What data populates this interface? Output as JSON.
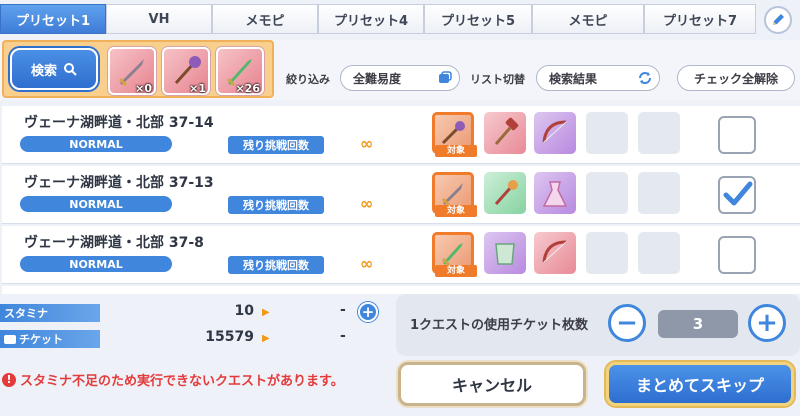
{
  "tabs": [
    {
      "label": "プリセット1",
      "active": true
    },
    {
      "label": "VH",
      "active": false
    },
    {
      "label": "メモピ",
      "active": false
    },
    {
      "label": "プリセット4",
      "active": false
    },
    {
      "label": "プリセット5",
      "active": false
    },
    {
      "label": "メモピ",
      "active": false
    },
    {
      "label": "プリセット7",
      "active": false
    }
  ],
  "edit_icon": "pencil-icon",
  "search": {
    "button_label": "検索",
    "icon": "magnifier-icon",
    "items": [
      {
        "icon": "sword-icon",
        "count": "×0"
      },
      {
        "icon": "staff-icon",
        "count": "×1"
      },
      {
        "icon": "green-sword-icon",
        "count": "×26"
      }
    ]
  },
  "filters": {
    "narrow_label": "絞り込み",
    "narrow_value": "全難易度",
    "list_switch_label": "リスト切替",
    "list_switch_value": "検索結果",
    "uncheck_all_label": "チェック全解除"
  },
  "quests": [
    {
      "name": "ヴェーナ湖畔道・北部 37-14",
      "difficulty": "NORMAL",
      "remaining_label": "残り挑戦回数",
      "remaining": "∞",
      "target_tag": "対象",
      "checked": false,
      "drops": [
        "staff-icon",
        "hammer-icon",
        "bow-icon"
      ]
    },
    {
      "name": "ヴェーナ湖畔道・北部 37-13",
      "difficulty": "NORMAL",
      "remaining_label": "残り挑戦回数",
      "remaining": "∞",
      "target_tag": "対象",
      "checked": true,
      "drops": [
        "sword-icon",
        "wand-icon",
        "dress-icon"
      ]
    },
    {
      "name": "ヴェーナ湖畔道・北部 37-8",
      "difficulty": "NORMAL",
      "remaining_label": "残り挑戦回数",
      "remaining": "∞",
      "target_tag": "対象",
      "checked": false,
      "drops": [
        "green-sword-icon",
        "armor-icon",
        "bow-icon"
      ]
    }
  ],
  "stats": {
    "stamina_label": "スタミナ",
    "stamina_value": "10",
    "stamina_after": "-",
    "ticket_label": "チケット",
    "ticket_value": "15579",
    "ticket_after": "-"
  },
  "ticket_panel": {
    "label": "1クエストの使用チケット枚数",
    "minus": "−",
    "value": "3",
    "plus": "+"
  },
  "warning": {
    "icon": "!",
    "text": "スタミナ不足のため実行できないクエストがあります。"
  },
  "buttons": {
    "cancel": "キャンセル",
    "skip": "まとめてスキップ"
  },
  "colors": {
    "accent_blue": "#3f86dc",
    "target_orange": "#f07b2b",
    "warning_red": "#e33b3b",
    "infinity_orange": "#f19a19"
  }
}
